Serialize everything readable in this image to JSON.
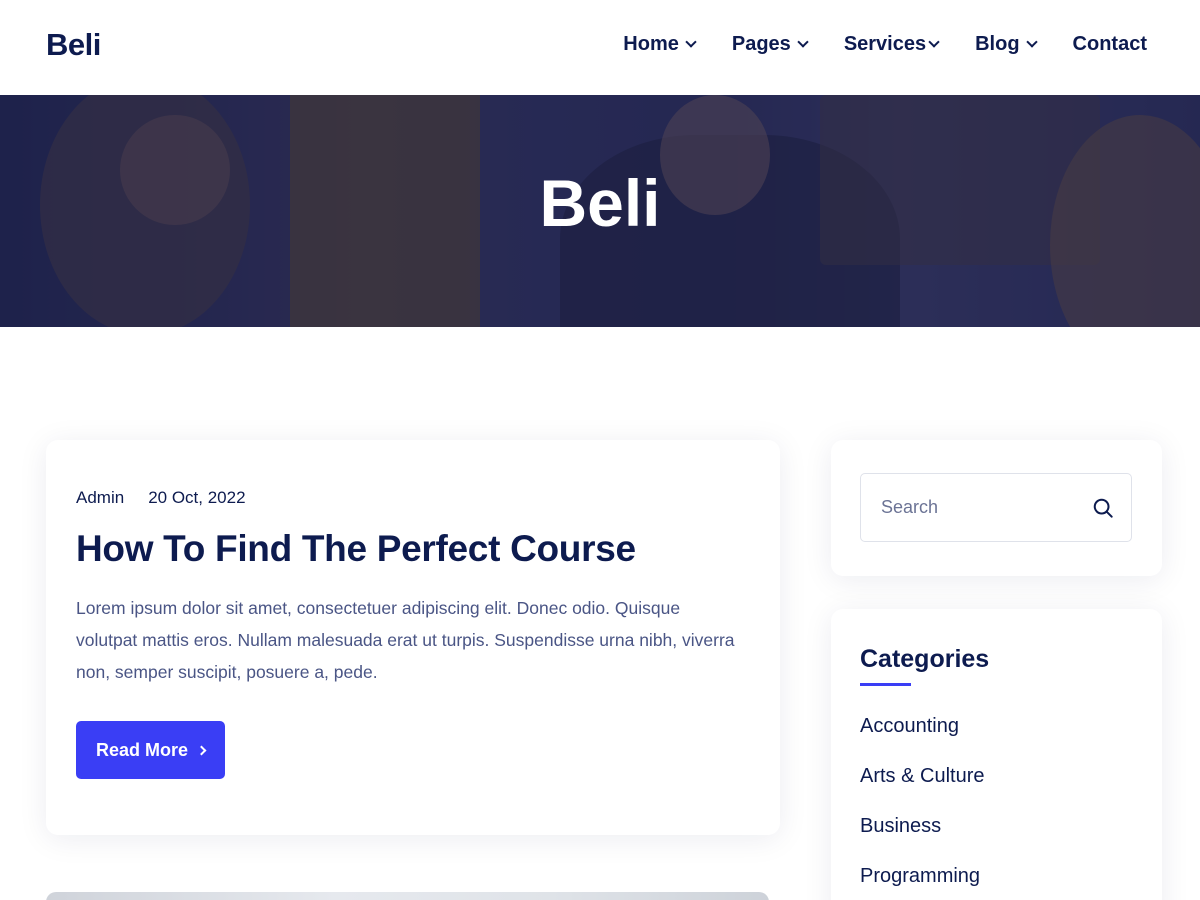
{
  "header": {
    "logo": "Beli",
    "nav": [
      {
        "label": "Home",
        "has_dropdown": true
      },
      {
        "label": "Pages",
        "has_dropdown": true
      },
      {
        "label": "Services",
        "has_dropdown": true
      },
      {
        "label": "Blog",
        "has_dropdown": true
      },
      {
        "label": "Contact",
        "has_dropdown": false
      }
    ]
  },
  "hero": {
    "title": "Beli"
  },
  "post": {
    "author": "Admin",
    "date": "20 Oct, 2022",
    "title": "How To Find The Perfect Course",
    "excerpt": "Lorem ipsum dolor sit amet, consectetuer adipiscing elit. Donec odio. Quisque volutpat mattis eros. Nullam malesuada erat ut turpis. Suspendisse urna nibh, viverra non, semper suscipit, posuere a, pede.",
    "read_more_label": "Read More"
  },
  "sidebar": {
    "search": {
      "placeholder": "Search",
      "icon": "search-icon"
    },
    "categories": {
      "title": "Categories",
      "items": [
        "Accounting",
        "Arts & Culture",
        "Business",
        "Programming"
      ]
    }
  },
  "colors": {
    "primary_text": "#0d1b4f",
    "accent": "#3a3ef5",
    "body_text": "#4a5585"
  }
}
